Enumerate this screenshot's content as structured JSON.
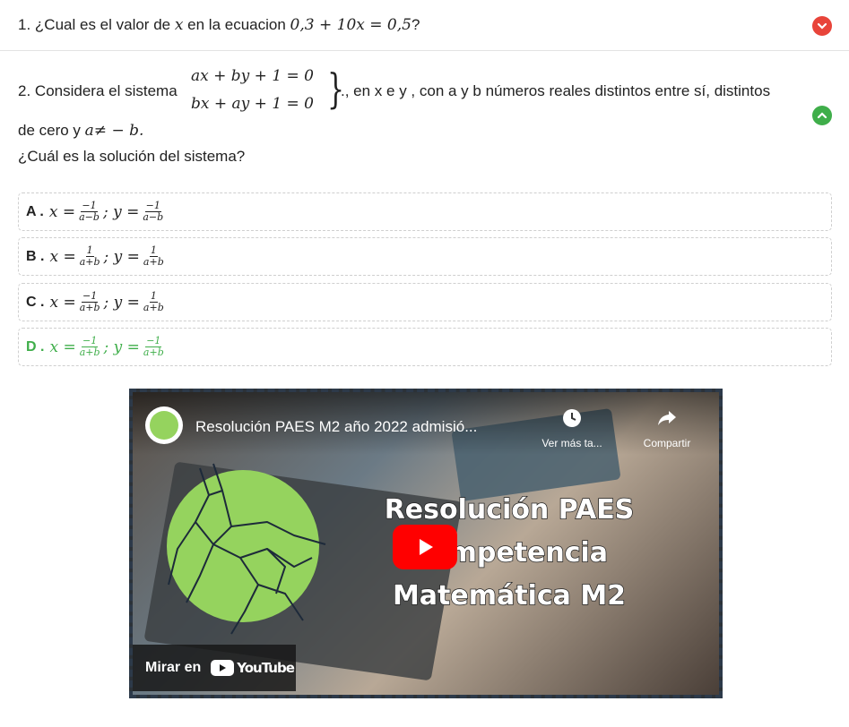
{
  "question1": {
    "number": "1.",
    "text_before": "¿Cual es el valor de",
    "var": "x",
    "text_middle": "en la ecuacion",
    "equation": "0,3 + 10x = 0,5",
    "text_after": "?",
    "toggle_color": "#e8443a"
  },
  "question2": {
    "number": "2.",
    "intro": "Considera el sistema",
    "eq1": "ax + by + 1 = 0",
    "eq2": "bx + ay + 1 = 0",
    "brace": "}",
    "rest": "., en x e y , con a y b números reales distintos entre sí, distintos",
    "line2_text": "de cero y",
    "line2_math": "a≠ − b.",
    "question": "¿Cuál es la solución del sistema?",
    "toggle_color": "#3fae4a"
  },
  "options": [
    {
      "letter": "A .",
      "xnum": "−1",
      "xden": "a−b",
      "ynum": "−1",
      "yden": "a−b",
      "correct": false
    },
    {
      "letter": "B .",
      "xnum": "1",
      "xden": "a+b",
      "ynum": "1",
      "yden": "a+b",
      "correct": false
    },
    {
      "letter": "C .",
      "xnum": "−1",
      "xden": "a+b",
      "ynum": "1",
      "yden": "a+b",
      "correct": false
    },
    {
      "letter": "D .",
      "xnum": "−1",
      "xden": "a+b",
      "ynum": "−1",
      "yden": "a+b",
      "correct": true
    }
  ],
  "option_parts": {
    "x_eq": "x =",
    "sep": "; y ="
  },
  "video": {
    "title": "Resolución PAES M2 año 2022 admisió...",
    "watch_later": "Ver más ta...",
    "share": "Compartir",
    "headline_1": "Resolución PAES",
    "headline_2": "Competencia",
    "headline_3": "Matemática M2",
    "watch_on": "Mirar en",
    "youtube": "YouTube",
    "border_color": "#2d3a4a",
    "play_color": "#ff0000"
  }
}
